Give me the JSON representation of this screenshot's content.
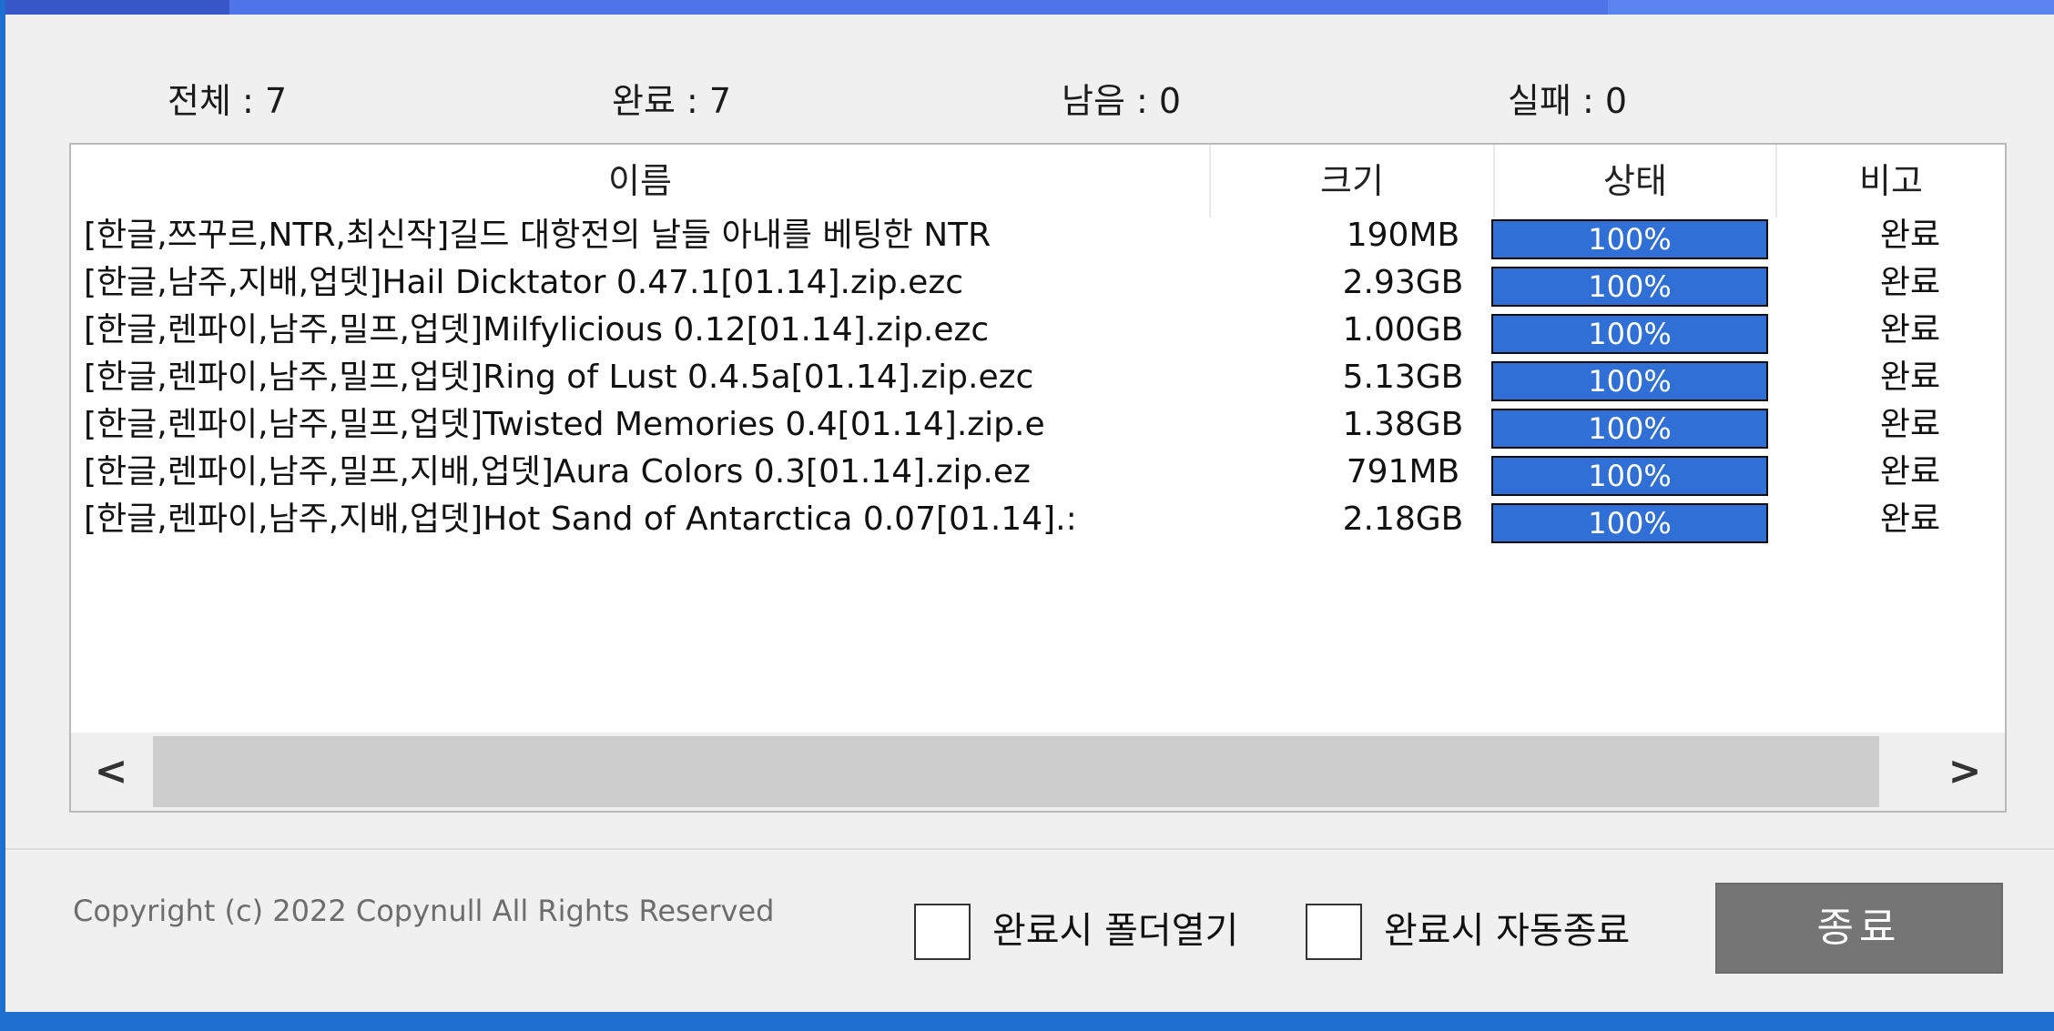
{
  "summary": {
    "total": "전체 : 7",
    "done": "완료 : 7",
    "remaining": "남음 : 0",
    "failed": "실패 : 0"
  },
  "table": {
    "columns": [
      "이름",
      "크기",
      "상태",
      "비고"
    ],
    "rows": [
      {
        "name": "[한글,쯔꾸르,NTR,최신작]길드 대항전의 날들 아내를 베팅한 NTR",
        "size": "190MB",
        "progress": 100,
        "status": "100%",
        "note": "완료"
      },
      {
        "name": "[한글,남주,지배,업뎃]Hail Dicktator 0.47.1[01.14].zip.ezc",
        "size": "2.93GB",
        "progress": 100,
        "status": "100%",
        "note": "완료"
      },
      {
        "name": "[한글,렌파이,남주,밀프,업뎃]Milfylicious 0.12[01.14].zip.ezc",
        "size": "1.00GB",
        "progress": 100,
        "status": "100%",
        "note": "완료"
      },
      {
        "name": "[한글,렌파이,남주,밀프,업뎃]Ring of Lust 0.4.5a[01.14].zip.ezc",
        "size": "5.13GB",
        "progress": 100,
        "status": "100%",
        "note": "완료"
      },
      {
        "name": "[한글,렌파이,남주,밀프,업뎃]Twisted Memories 0.4[01.14].zip.e",
        "size": "1.38GB",
        "progress": 100,
        "status": "100%",
        "note": "완료"
      },
      {
        "name": "[한글,렌파이,남주,밀프,지배,업뎃]Aura Colors 0.3[01.14].zip.ez",
        "size": "791MB",
        "progress": 100,
        "status": "100%",
        "note": "완료"
      },
      {
        "name": "[한글,렌파이,남주,지배,업뎃]Hot Sand of Antarctica 0.07[01.14].:",
        "size": "2.18GB",
        "progress": 100,
        "status": "100%",
        "note": "완료"
      }
    ]
  },
  "scrollbar": {
    "left_icon": "chevron-left-icon",
    "right_icon": "chevron-right-icon",
    "left_glyph": "<",
    "right_glyph": ">"
  },
  "footer": {
    "copyright": "Copyright (c) 2022 Copynull All Rights Reserved",
    "open_folder_label": "완료시 폴더열기",
    "auto_exit_label": "완료시 자동종료",
    "exit_button": "종료"
  },
  "colors": {
    "progress_fill": "#2f6fd6",
    "taskbar": "#1f6fd0",
    "button": "#757575"
  }
}
